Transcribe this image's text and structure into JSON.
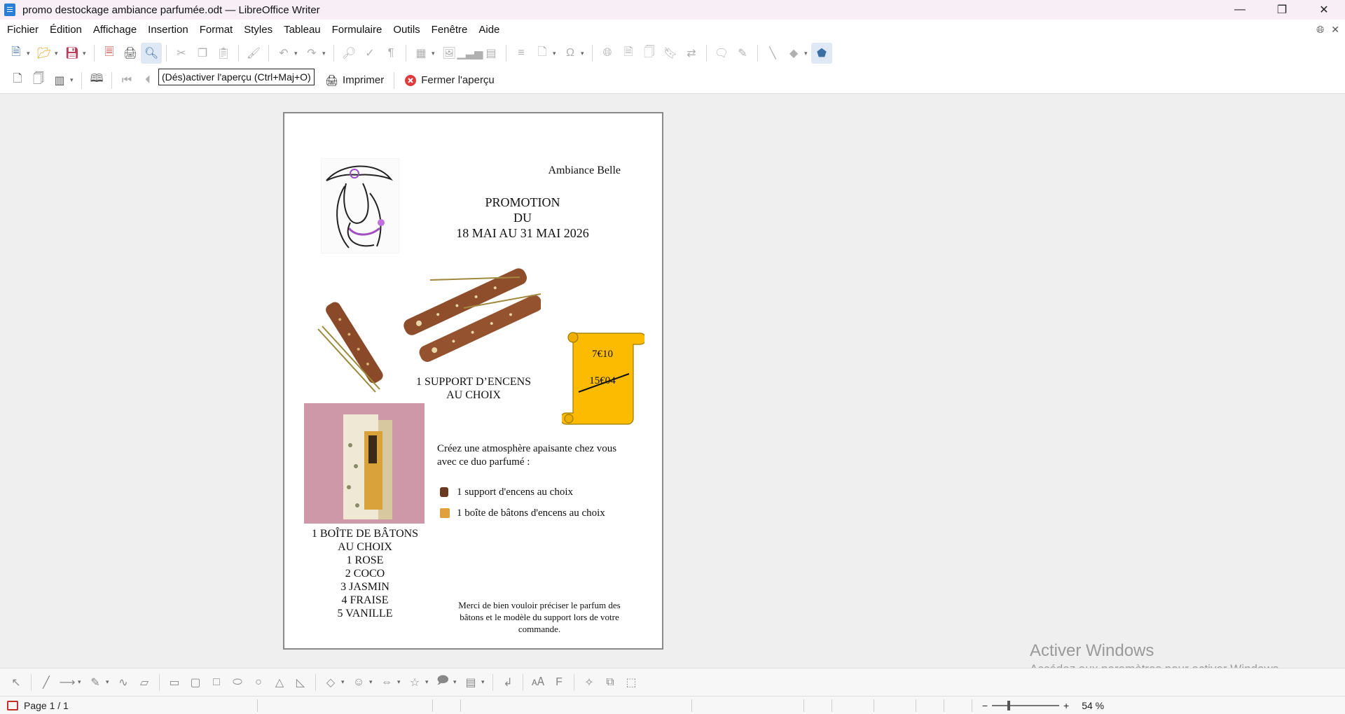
{
  "window": {
    "title": "promo destockage ambiance parfumée.odt — LibreOffice Writer",
    "controls": [
      "minimize",
      "restore",
      "close"
    ]
  },
  "menu": [
    "Fichier",
    "Édition",
    "Affichage",
    "Insertion",
    "Format",
    "Styles",
    "Tableau",
    "Formulaire",
    "Outils",
    "Fenêtre",
    "Aide"
  ],
  "preview_toolbar": {
    "print_label": "Imprimer",
    "close_preview_label": "Fermer l'aperçu",
    "tooltip": "(Dés)activer l'aperçu (Ctrl+Maj+O)"
  },
  "document": {
    "header_brand": "Ambiance Belle",
    "promo_line1": "PROMOTION",
    "promo_line2": "DU",
    "promo_line3": "18 MAI AU 31 MAI 2026",
    "support_caption_1": "1 SUPPORT D’ENCENS",
    "support_caption_2": "AU CHOIX",
    "price_new": "7€10",
    "price_old": "15€04",
    "intro_1": "Créez une atmosphère apaisante chez vous",
    "intro_2": "avec ce duo parfumé :",
    "bullet_1": "1 support d'encens au choix",
    "bullet_2": "1 boîte de bâtons d'encens au choix",
    "box_title_1": "1 BOÎTE DE BÂTONS",
    "box_title_2": "AU CHOIX",
    "scents": [
      "1 ROSE",
      "2 COCO",
      "3 JASMIN",
      "4 FRAISE",
      "5 VANILLE"
    ],
    "note_1": "Merci de bien vouloir préciser le parfum des",
    "note_2": "bâtons et le modèle du support lors de votre",
    "note_3": "commande."
  },
  "watermark": {
    "line1": "Activer Windows",
    "line2": "Accédez aux paramètres pour activer Windows."
  },
  "status": {
    "page": "Page 1 / 1",
    "zoom": "54 %"
  },
  "colors": {
    "scroll": "#fdbb00",
    "wood": "#8a4a2a",
    "box_bg": "#cf98a8",
    "close_icon": "#e03a3a"
  }
}
